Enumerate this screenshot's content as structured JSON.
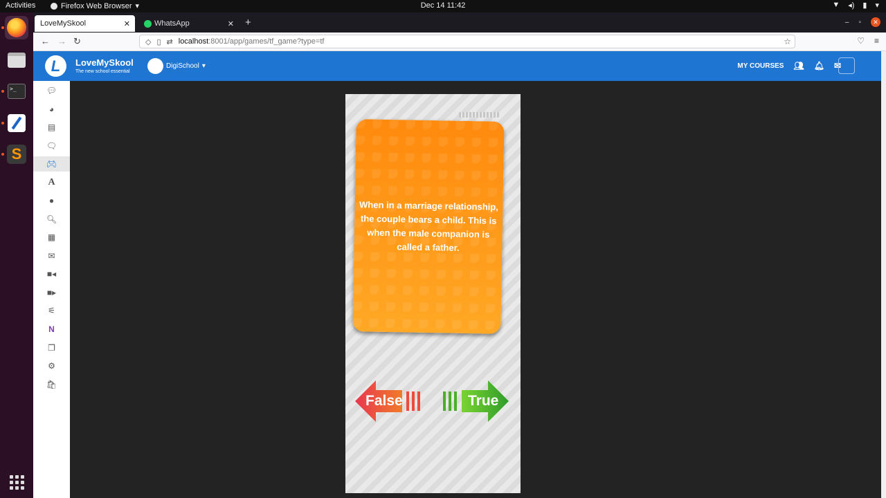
{
  "system": {
    "activities": "Activities",
    "app_menu": "Firefox Web Browser",
    "clock": "Dec 14  11:42"
  },
  "browser": {
    "tabs": [
      {
        "label": "LoveMySkool"
      },
      {
        "label": "WhatsApp"
      }
    ],
    "url": {
      "host": "localhost",
      "path": ":8001/app/games/tf_game?type=tf"
    }
  },
  "app": {
    "brand_name": "LoveMySkool",
    "tagline": "The new school essential",
    "logo_letter": "L",
    "school_name": "DigiSchool",
    "my_courses": "MY COURSES"
  },
  "sidebar_icons": [
    "chat-icon",
    "dashboard-icon",
    "library-icon",
    "forum-icon",
    "games-icon",
    "font-icon",
    "profile-icon",
    "search-icon",
    "calendar-icon",
    "mail-icon",
    "video-call-icon",
    "video-icon",
    "satellite-icon",
    "onenote-icon",
    "files-icon",
    "settings-icon",
    "shop-icon"
  ],
  "game": {
    "statement": "When in a marriage relationship, the couple bears a child. This is when the male companion is called a father.",
    "false_label": "False",
    "true_label": "True",
    "colors": {
      "card_top": "#ff8a0d",
      "card_bottom": "#ffa825",
      "false_arrow": "#e8364f",
      "true_arrow": "#3faf2a"
    }
  }
}
